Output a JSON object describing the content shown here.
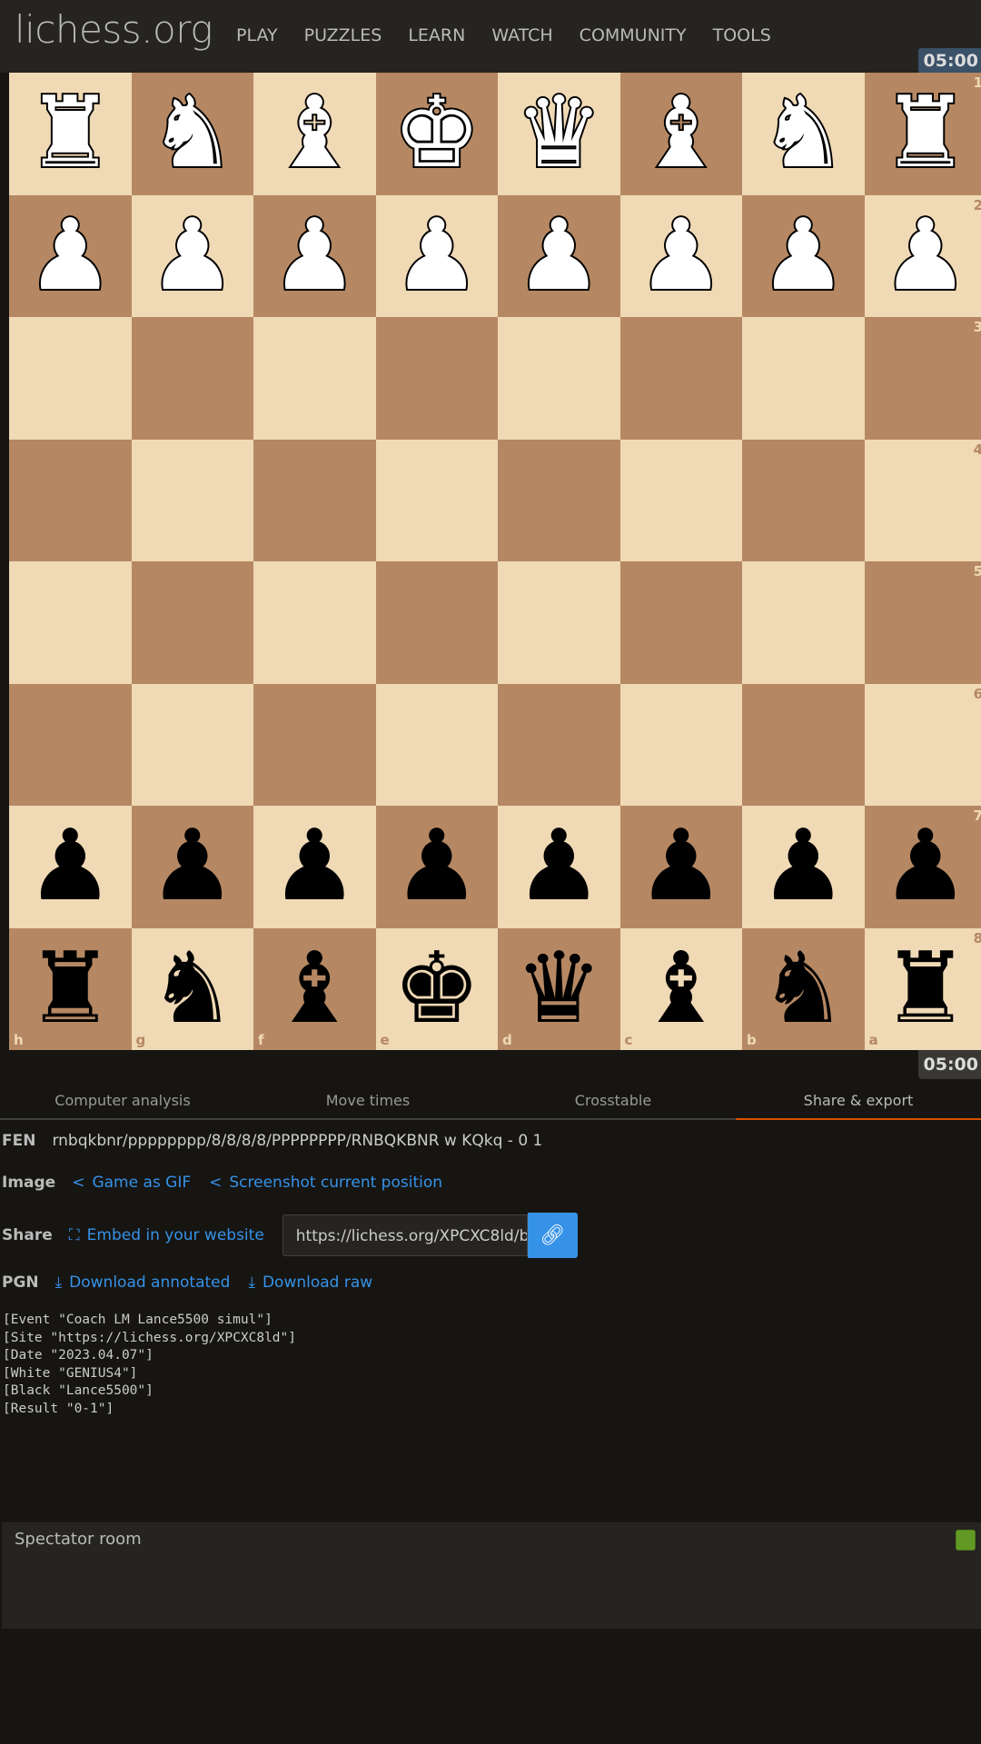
{
  "header": {
    "logo": "lichess.org",
    "nav": [
      "PLAY",
      "PUZZLES",
      "LEARN",
      "WATCH",
      "COMMUNITY",
      "TOOLS"
    ]
  },
  "clocks": {
    "top": "05:00",
    "bottom": "05:00"
  },
  "board": {
    "orientation": "black",
    "light_color": "#f0d9b5",
    "dark_color": "#b58863",
    "files": [
      "h",
      "g",
      "f",
      "e",
      "d",
      "c",
      "b",
      "a"
    ],
    "ranks": [
      "1",
      "2",
      "3",
      "4",
      "5",
      "6",
      "7",
      "8"
    ],
    "rows": [
      [
        "wR",
        "wN",
        "wB",
        "wK",
        "wQ",
        "wB",
        "wN",
        "wR"
      ],
      [
        "wP",
        "wP",
        "wP",
        "wP",
        "wP",
        "wP",
        "wP",
        "wP"
      ],
      [
        "",
        "",
        "",
        "",
        "",
        "",
        "",
        ""
      ],
      [
        "",
        "",
        "",
        "",
        "",
        "",
        "",
        ""
      ],
      [
        "",
        "",
        "",
        "",
        "",
        "",
        "",
        ""
      ],
      [
        "",
        "",
        "",
        "",
        "",
        "",
        "",
        ""
      ],
      [
        "bP",
        "bP",
        "bP",
        "bP",
        "bP",
        "bP",
        "bP",
        "bP"
      ],
      [
        "bR",
        "bN",
        "bB",
        "bK",
        "bQ",
        "bB",
        "bN",
        "bR"
      ]
    ]
  },
  "tabs": [
    {
      "label": "Computer analysis",
      "active": false
    },
    {
      "label": "Move times",
      "active": false
    },
    {
      "label": "Crosstable",
      "active": false
    },
    {
      "label": "Share & export",
      "active": true
    }
  ],
  "export": {
    "fen_label": "FEN",
    "fen": "rnbqkbnr/pppppppp/8/8/8/8/PPPPPPPP/RNBQKBNR w KQkq - 0 1",
    "image_label": "Image",
    "gif_link": "Game as GIF",
    "screenshot_link": "Screenshot current position",
    "share_label": "Share",
    "embed_link": "Embed in your website",
    "share_url": "https://lichess.org/XPCXC8ld/b",
    "pgn_label": "PGN",
    "download_annotated": "Download annotated",
    "download_raw": "Download raw",
    "pgn_text": "[Event \"Coach LM Lance5500 simul\"]\n[Site \"https://lichess.org/XPCXC8ld\"]\n[Date \"2023.04.07\"]\n[White \"GENIUS4\"]\n[Black \"Lance5500\"]\n[Result \"0-1\"]"
  },
  "chat": {
    "title": "Spectator room",
    "toggle_color": "#629924"
  }
}
